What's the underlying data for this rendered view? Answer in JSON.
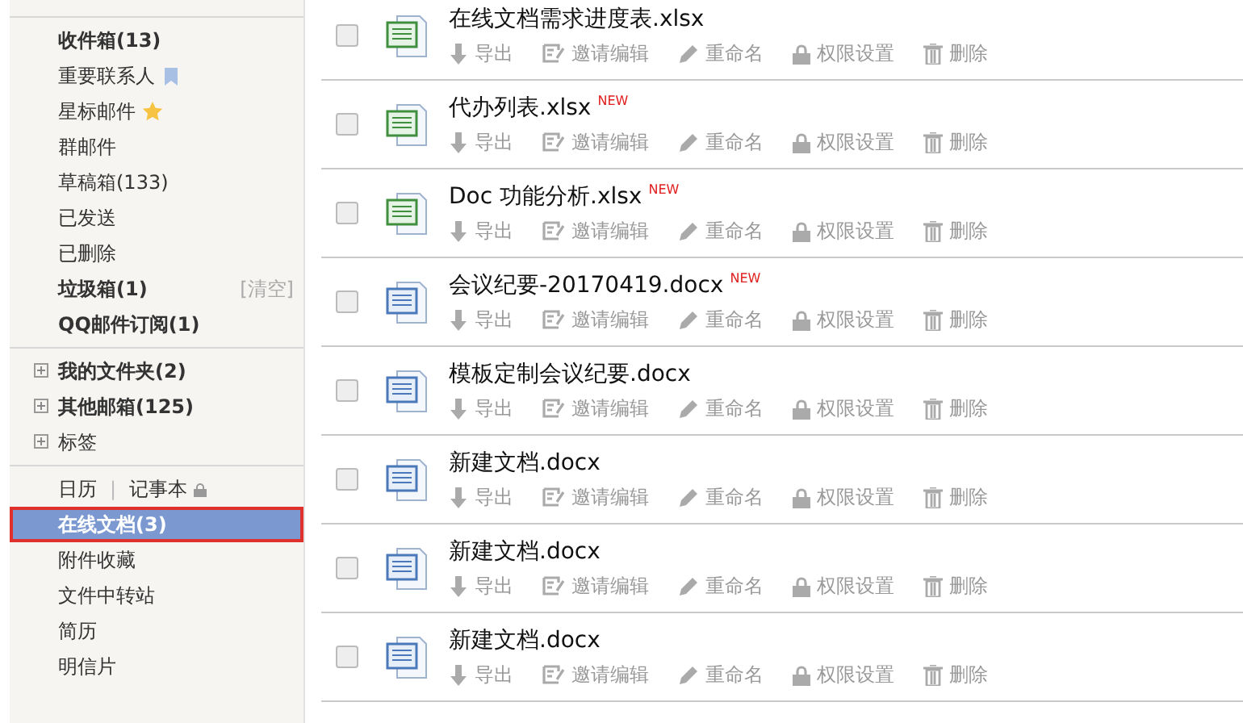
{
  "sidebar": {
    "groups": [
      {
        "items": [
          {
            "label": "收件箱(13)",
            "bold": true,
            "selected": false
          },
          {
            "label": "重要联系人",
            "bold": false,
            "selected": false,
            "kind": "bookmark"
          },
          {
            "label": "星标邮件",
            "bold": false,
            "selected": false,
            "kind": "star"
          },
          {
            "label": "群邮件",
            "bold": false,
            "selected": false
          },
          {
            "label": "草稿箱(133)",
            "bold": false,
            "selected": false
          },
          {
            "label": "已发送",
            "bold": false,
            "selected": false
          },
          {
            "label": "已删除",
            "bold": false,
            "selected": false
          },
          {
            "label": "垃圾箱(1)",
            "bold": true,
            "selected": false,
            "action": "[清空]"
          },
          {
            "label": "QQ邮件订阅(1)",
            "bold": true,
            "selected": false
          }
        ]
      },
      {
        "items": [
          {
            "label": "我的文件夹(2)",
            "bold": true,
            "selected": false,
            "expanded": false
          },
          {
            "label": "其他邮箱(125)",
            "bold": true,
            "selected": false,
            "expanded": false
          },
          {
            "label": "标签",
            "bold": false,
            "selected": false,
            "expanded": false
          }
        ]
      },
      {
        "items": [
          {
            "label": "日历",
            "bold": false,
            "selected": false,
            "separator": "|",
            "link2": "记事本"
          },
          {
            "label": "在线文档(3)",
            "bold": true,
            "selected": true
          },
          {
            "label": "附件收藏",
            "bold": false,
            "selected": false
          },
          {
            "label": "文件中转站",
            "bold": false,
            "selected": false
          },
          {
            "label": "简历",
            "bold": false,
            "selected": false
          },
          {
            "label": "明信片",
            "bold": false,
            "selected": false
          }
        ]
      }
    ]
  },
  "files": [
    {
      "name": "在线文档需求进度表.xlsx",
      "kind": "xlsx",
      "checked": false,
      "actions": [
        "导出",
        "邀请编辑",
        "重命名",
        "权限设置",
        "删除"
      ]
    },
    {
      "name": "代办列表.xlsx",
      "kind": "xlsx",
      "badge": "NEW",
      "checked": false,
      "actions": [
        "导出",
        "邀请编辑",
        "重命名",
        "权限设置",
        "删除"
      ]
    },
    {
      "name": "Doc 功能分析.xlsx",
      "kind": "xlsx",
      "badge": "NEW",
      "checked": false,
      "actions": [
        "导出",
        "邀请编辑",
        "重命名",
        "权限设置",
        "删除"
      ]
    },
    {
      "name": "会议纪要-20170419.docx",
      "kind": "docx",
      "badge": "NEW",
      "checked": false,
      "actions": [
        "导出",
        "邀请编辑",
        "重命名",
        "权限设置",
        "删除"
      ]
    },
    {
      "name": "模板定制会议纪要.docx",
      "kind": "docx",
      "checked": false,
      "actions": [
        "导出",
        "邀请编辑",
        "重命名",
        "权限设置",
        "删除"
      ]
    },
    {
      "name": "新建文档.docx",
      "kind": "docx",
      "checked": false,
      "actions": [
        "导出",
        "邀请编辑",
        "重命名",
        "权限设置",
        "删除"
      ]
    },
    {
      "name": "新建文档.docx",
      "kind": "docx",
      "checked": false,
      "actions": [
        "导出",
        "邀请编辑",
        "重命名",
        "权限设置",
        "删除"
      ]
    },
    {
      "name": "新建文档.docx",
      "kind": "docx",
      "checked": false,
      "actions": [
        "导出",
        "邀请编辑",
        "重命名",
        "权限设置",
        "删除"
      ]
    }
  ]
}
